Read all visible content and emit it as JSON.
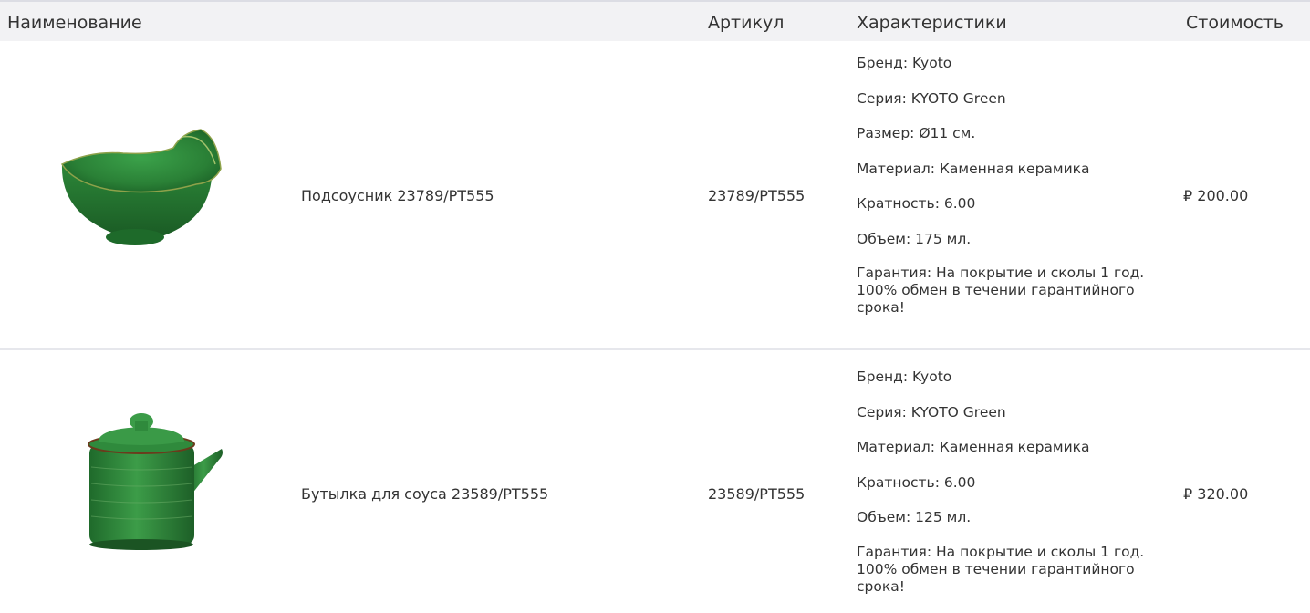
{
  "columns": {
    "name": "Наименование",
    "sku": "Артикул",
    "characteristics": "Характеристики",
    "price": "Стоимость"
  },
  "products": [
    {
      "name": "Подсоусник 23789/PT555",
      "sku": "23789/PT555",
      "price": "₽ 200.00",
      "image_icon": "green-sauce-bowl-image",
      "chars": [
        {
          "k": "Бренд",
          "v": "Kyoto"
        },
        {
          "k": "Серия",
          "v": "KYOTO Green"
        },
        {
          "k": "Размер",
          "v": "Ø11 см."
        },
        {
          "k": "Материал",
          "v": "Каменная керамика"
        },
        {
          "k": "Кратность",
          "v": "6.00"
        },
        {
          "k": "Объем",
          "v": "175 мл."
        },
        {
          "k": "Гарантия",
          "v": "На покрытие и сколы 1 год. 100% обмен в течении гарантийного срока!"
        }
      ]
    },
    {
      "name": "Бутылка для соуса 23589/PT555",
      "sku": "23589/PT555",
      "price": "₽ 320.00",
      "image_icon": "green-sauce-bottle-image",
      "chars": [
        {
          "k": "Бренд",
          "v": "Kyoto"
        },
        {
          "k": "Серия",
          "v": "KYOTO Green"
        },
        {
          "k": "Материал",
          "v": "Каменная керамика"
        },
        {
          "k": "Кратность",
          "v": "6.00"
        },
        {
          "k": "Объем",
          "v": "125 мл."
        },
        {
          "k": "Гарантия",
          "v": "На покрытие и сколы 1 год. 100% обмен в течении гарантийного срока!"
        }
      ]
    }
  ],
  "colors": {
    "header_bg": "#f2f2f4",
    "text": "#333333",
    "glaze": "#2f8a3c"
  }
}
